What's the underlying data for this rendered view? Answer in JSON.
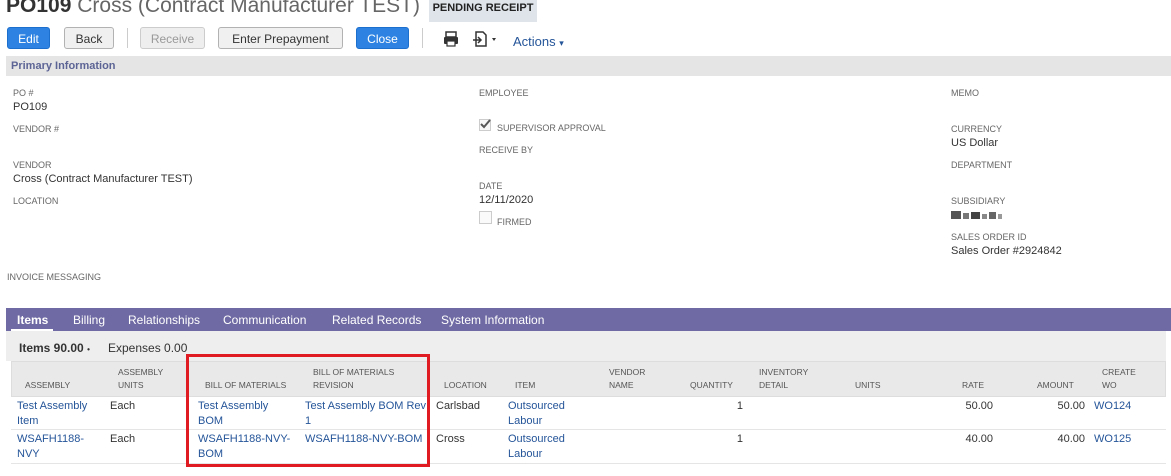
{
  "header": {
    "record_id": "PO109",
    "vendor_name": "Cross (Contract Manufacturer TEST)",
    "status": "PENDING RECEIPT"
  },
  "toolbar": {
    "edit": "Edit",
    "back": "Back",
    "receive": "Receive",
    "enter_prepayment": "Enter Prepayment",
    "close": "Close",
    "actions": "Actions"
  },
  "primary": {
    "section_title": "Primary Information",
    "po_label": "PO #",
    "po_value": "PO109",
    "vendor_num_label": "VENDOR #",
    "vendor_label": "VENDOR",
    "vendor_value": "Cross (Contract Manufacturer TEST)",
    "location_label": "LOCATION",
    "employee_label": "EMPLOYEE",
    "supervisor_label": "SUPERVISOR APPROVAL",
    "receive_by_label": "RECEIVE BY",
    "date_label": "DATE",
    "date_value": "12/11/2020",
    "firmed_label": "FIRMED",
    "memo_label": "MEMO",
    "currency_label": "CURRENCY",
    "currency_value": "US Dollar",
    "department_label": "DEPARTMENT",
    "subsidiary_label": "SUBSIDIARY",
    "sales_order_label": "SALES ORDER ID",
    "sales_order_value": "Sales Order #2924842",
    "invoice_label": "INVOICE MESSAGING"
  },
  "tabs": [
    "Items",
    "Billing",
    "Relationships",
    "Communication",
    "Related Records",
    "System Information"
  ],
  "subtabs": {
    "items": "Items 90.00",
    "expenses": "Expenses 0.00"
  },
  "table": {
    "headers": {
      "assembly": "ASSEMBLY",
      "assembly_units_1": "ASSEMBLY",
      "assembly_units_2": "UNITS",
      "bom": "BILL OF MATERIALS",
      "bom_rev_1": "BILL OF MATERIALS",
      "bom_rev_2": "REVISION",
      "location": "LOCATION",
      "item": "ITEM",
      "vendor_name_1": "VENDOR",
      "vendor_name_2": "NAME",
      "quantity": "QUANTITY",
      "inv_detail_1": "INVENTORY",
      "inv_detail_2": "DETAIL",
      "units": "UNITS",
      "rate": "RATE",
      "amount": "AMOUNT",
      "create_wo_1": "CREATE",
      "create_wo_2": "WO"
    },
    "rows": [
      {
        "assembly_1": "Test Assembly",
        "assembly_2": "Item",
        "units": "Each",
        "bom_1": "Test Assembly",
        "bom_2": "BOM",
        "bom_rev_1": "Test Assembly BOM Rev",
        "bom_rev_2": "1",
        "location": "Carlsbad",
        "item_1": "Outsourced",
        "item_2": "Labour",
        "quantity": "1",
        "rate": "50.00",
        "amount": "50.00",
        "wo": "WO124"
      },
      {
        "assembly_1": "WSAFH1188-",
        "assembly_2": "NVY",
        "units": "Each",
        "bom_1": "WSAFH1188-NVY-",
        "bom_2": "BOM",
        "bom_rev_1": "WSAFH1188-NVY-BOM",
        "bom_rev_2": "",
        "location": "Cross",
        "item_1": "Outsourced",
        "item_2": "Labour",
        "quantity": "1",
        "rate": "40.00",
        "amount": "40.00",
        "wo": "WO125"
      }
    ]
  },
  "colors": {
    "primary_button": "#2e83e2",
    "tab_bar": "#6f6aa3",
    "link": "#255599",
    "highlight": "#e01b22"
  }
}
